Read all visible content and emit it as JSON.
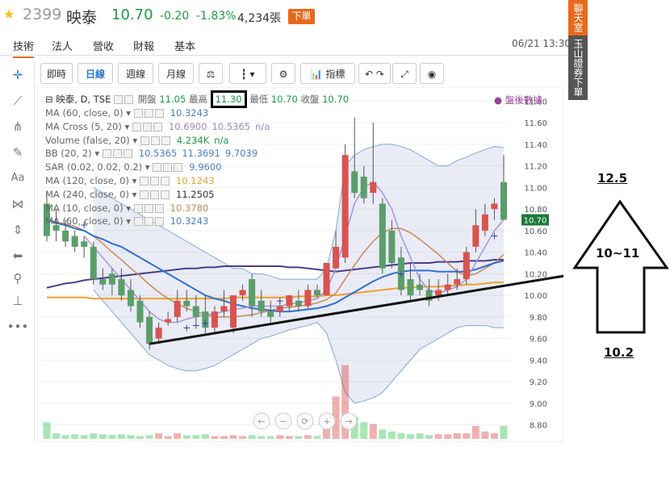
{
  "header": {
    "star_icon": "star-icon",
    "code": "2399",
    "name": "映泰",
    "price": "10.70",
    "change": "-0.20",
    "change_pct": "-1.83%",
    "volume": "4,234張",
    "order_button": "下單",
    "up_color": "#d9534f",
    "down_color": "#1b9a45"
  },
  "tabs": [
    "技術",
    "法人",
    "營收",
    "財報",
    "基本"
  ],
  "timestamp": "06/21 13:30",
  "promo": {
    "top": "聊天室",
    "text": "玉山證券下單"
  },
  "toolbar": {
    "buttons": [
      "即時",
      "日線",
      "週線",
      "月線"
    ],
    "indicator_label": "指標"
  },
  "legend": {
    "main_title": "映泰, D, TSE",
    "open_label": "開盤",
    "open": "11.05",
    "high_label": "最高",
    "high": "11.30",
    "low_label": "最低",
    "low": "10.70",
    "close_label": "收盤",
    "close": "10.70",
    "after_hours": "盤後數據",
    "lines": [
      {
        "name": "MA (60, close, 0)",
        "value": "10.3243",
        "color": "#4a7fc4"
      },
      {
        "name": "MA Cross (5, 20)",
        "value": "10.6900",
        "value2": "10.5365",
        "value3": "n/a",
        "color": "#9b88c4"
      },
      {
        "name": "Volume (false, 20)",
        "value": "4.234K",
        "value2": "n/a",
        "color": "#1b9a45"
      },
      {
        "name": "BB (20, 2)",
        "value": "10.5365",
        "value2": "11.3691",
        "value3": "9.7039",
        "color": "#4a7fc4"
      },
      {
        "name": "SAR (0.02, 0.02, 0.2)",
        "value": "9.9600",
        "color": "#4a7fc4"
      },
      {
        "name": "MA (120, close, 0)",
        "value": "10.1243",
        "color": "#f0a030"
      },
      {
        "name": "MA (240, close, 0)",
        "value": "11.2505",
        "color": "#333333"
      },
      {
        "name": "MA (10, close, 0)",
        "value": "10.3780",
        "color": "#c88a5a"
      },
      {
        "name": "MA (60, close, 0)",
        "value": "10.3243",
        "color": "#4a7fc4"
      }
    ]
  },
  "annotations": {
    "target": "12.5",
    "range": "10~11",
    "base": "10.2"
  },
  "chart_data": {
    "type": "candlestick",
    "ylim": [
      8.7,
      11.9
    ],
    "y_ticks": [
      "11.80",
      "11.60",
      "11.40",
      "11.20",
      "11.00",
      "10.80",
      "10.60",
      "10.40",
      "10.20",
      "10.00",
      "9.80",
      "9.60",
      "9.40",
      "9.20",
      "9.00",
      "8.80"
    ],
    "last_price_label": "10.70",
    "candles": [
      {
        "o": 10.85,
        "h": 10.95,
        "c": 10.55,
        "l": 10.5
      },
      {
        "o": 10.65,
        "h": 10.8,
        "c": 10.6,
        "l": 10.5
      },
      {
        "o": 10.6,
        "h": 10.7,
        "c": 10.5,
        "l": 10.45
      },
      {
        "o": 10.55,
        "h": 10.6,
        "c": 10.45,
        "l": 10.4
      },
      {
        "o": 10.5,
        "h": 10.55,
        "c": 10.45,
        "l": 10.35
      },
      {
        "o": 10.45,
        "h": 10.5,
        "c": 10.15,
        "l": 10.1
      },
      {
        "o": 10.15,
        "h": 10.25,
        "c": 10.1,
        "l": 10.05
      },
      {
        "o": 10.2,
        "h": 10.25,
        "c": 10.1,
        "l": 10.0
      },
      {
        "o": 10.15,
        "h": 10.25,
        "c": 10.0,
        "l": 9.95
      },
      {
        "o": 10.05,
        "h": 10.15,
        "c": 9.9,
        "l": 9.85
      },
      {
        "o": 9.95,
        "h": 10.0,
        "c": 9.75,
        "l": 9.7
      },
      {
        "o": 9.8,
        "h": 9.85,
        "c": 9.55,
        "l": 9.5
      },
      {
        "o": 9.6,
        "h": 9.75,
        "c": 9.7,
        "l": 9.55
      },
      {
        "o": 9.75,
        "h": 9.85,
        "c": 9.78,
        "l": 9.72
      },
      {
        "o": 9.8,
        "h": 10.05,
        "c": 9.95,
        "l": 9.75
      },
      {
        "o": 9.95,
        "h": 10.05,
        "c": 9.9,
        "l": 9.85
      },
      {
        "o": 9.9,
        "h": 10.0,
        "c": 9.8,
        "l": 9.75
      },
      {
        "o": 9.85,
        "h": 10.0,
        "c": 9.7,
        "l": 9.65
      },
      {
        "o": 9.7,
        "h": 9.9,
        "c": 9.85,
        "l": 9.65
      },
      {
        "o": 9.85,
        "h": 10.05,
        "c": 9.9,
        "l": 9.8
      },
      {
        "o": 9.7,
        "h": 10.0,
        "c": 10.0,
        "l": 9.65
      },
      {
        "o": 10.0,
        "h": 10.1,
        "c": 10.05,
        "l": 9.95
      },
      {
        "o": 10.15,
        "h": 10.2,
        "c": 9.9,
        "l": 9.8
      },
      {
        "o": 9.95,
        "h": 10.05,
        "c": 9.85,
        "l": 9.8
      },
      {
        "o": 9.85,
        "h": 9.95,
        "c": 9.8,
        "l": 9.75
      },
      {
        "o": 9.85,
        "h": 9.95,
        "c": 9.9,
        "l": 9.8
      },
      {
        "o": 9.9,
        "h": 10.0,
        "c": 10.0,
        "l": 9.85
      },
      {
        "o": 9.95,
        "h": 10.05,
        "c": 9.9,
        "l": 9.85
      },
      {
        "o": 9.9,
        "h": 10.1,
        "c": 10.05,
        "l": 9.88
      },
      {
        "o": 10.05,
        "h": 10.1,
        "c": 10.0,
        "l": 9.98
      },
      {
        "o": 10.0,
        "h": 10.3,
        "c": 10.3,
        "l": 10.0
      },
      {
        "o": 10.25,
        "h": 10.6,
        "c": 10.45,
        "l": 10.25
      },
      {
        "o": 10.35,
        "h": 11.4,
        "c": 11.3,
        "l": 10.3
      },
      {
        "o": 11.15,
        "h": 11.65,
        "c": 10.95,
        "l": 10.9
      },
      {
        "o": 11.1,
        "h": 11.2,
        "c": 10.9,
        "l": 10.85
      },
      {
        "o": 10.95,
        "h": 11.6,
        "c": 11.05,
        "l": 10.85
      },
      {
        "o": 10.85,
        "h": 10.9,
        "c": 10.25,
        "l": 10.2
      },
      {
        "o": 10.6,
        "h": 10.7,
        "c": 10.3,
        "l": 10.25
      },
      {
        "o": 10.35,
        "h": 10.45,
        "c": 10.05,
        "l": 10.0
      },
      {
        "o": 10.15,
        "h": 10.3,
        "c": 10.0,
        "l": 9.95
      },
      {
        "o": 10.1,
        "h": 10.2,
        "c": 10.05,
        "l": 10.0
      },
      {
        "o": 10.05,
        "h": 10.15,
        "c": 9.95,
        "l": 9.9
      },
      {
        "o": 10.0,
        "h": 10.15,
        "c": 10.05,
        "l": 9.95
      },
      {
        "o": 10.05,
        "h": 10.2,
        "c": 10.1,
        "l": 10.0
      },
      {
        "o": 10.1,
        "h": 10.25,
        "c": 10.15,
        "l": 10.05
      },
      {
        "o": 10.15,
        "h": 10.45,
        "c": 10.4,
        "l": 10.1
      },
      {
        "o": 10.45,
        "h": 10.8,
        "c": 10.65,
        "l": 10.4
      },
      {
        "o": 10.6,
        "h": 10.85,
        "c": 10.75,
        "l": 10.55
      },
      {
        "o": 10.8,
        "h": 10.9,
        "c": 10.85,
        "l": 10.7
      },
      {
        "o": 11.05,
        "h": 11.3,
        "c": 10.7,
        "l": 10.7
      }
    ],
    "volumes": [
      0.9,
      0.3,
      0.2,
      0.25,
      0.2,
      0.3,
      0.25,
      0.2,
      0.25,
      0.2,
      0.15,
      0.2,
      0.3,
      0.15,
      0.3,
      0.2,
      0.2,
      0.25,
      0.15,
      0.15,
      0.2,
      0.15,
      0.2,
      0.15,
      0.15,
      0.2,
      0.15,
      0.15,
      0.2,
      0.15,
      0.6,
      2.3,
      4.0,
      1.2,
      0.9,
      0.8,
      0.5,
      0.4,
      0.3,
      0.25,
      0.3,
      0.2,
      0.25,
      0.25,
      0.3,
      0.3,
      0.7,
      0.4,
      0.3,
      0.7
    ],
    "bb_upper": [
      null,
      null,
      null,
      null,
      null,
      11.0,
      10.95,
      10.9,
      10.85,
      10.8,
      10.75,
      10.7,
      10.65,
      10.6,
      10.55,
      10.5,
      10.45,
      10.4,
      10.35,
      10.3,
      10.25,
      10.25,
      10.2,
      10.2,
      10.18,
      10.15,
      10.15,
      10.15,
      10.15,
      10.15,
      10.25,
      10.6,
      11.2,
      11.3,
      11.35,
      11.38,
      11.4,
      11.4,
      11.38,
      11.35,
      11.3,
      11.25,
      11.2,
      11.2,
      11.25,
      11.28,
      11.32,
      11.35,
      11.38,
      11.37
    ],
    "bb_lower": [
      null,
      null,
      null,
      null,
      null,
      10.05,
      9.95,
      9.85,
      9.75,
      9.65,
      9.55,
      9.45,
      9.4,
      9.35,
      9.32,
      9.3,
      9.3,
      9.32,
      9.35,
      9.4,
      9.45,
      9.5,
      9.55,
      9.6,
      9.62,
      9.65,
      9.68,
      9.7,
      9.72,
      9.75,
      9.65,
      9.4,
      9.1,
      9.0,
      9.02,
      9.05,
      9.1,
      9.2,
      9.3,
      9.4,
      9.5,
      9.55,
      9.6,
      9.65,
      9.7,
      9.72,
      9.72,
      9.72,
      9.7,
      9.7
    ],
    "ma60": [
      10.7,
      10.67,
      10.65,
      10.62,
      10.6,
      10.55,
      10.52,
      10.48,
      10.45,
      10.4,
      10.35,
      10.3,
      10.25,
      10.2,
      10.15,
      10.1,
      10.05,
      10.0,
      9.97,
      9.95,
      9.92,
      9.9,
      9.88,
      9.87,
      9.86,
      9.85,
      9.85,
      9.86,
      9.87,
      9.88,
      9.9,
      9.93,
      9.98,
      10.03,
      10.08,
      10.13,
      10.17,
      10.2,
      10.22,
      10.23,
      10.23,
      10.23,
      10.22,
      10.22,
      10.22,
      10.22,
      10.24,
      10.27,
      10.3,
      10.32
    ],
    "ma120": [
      9.98,
      9.98,
      9.98,
      9.98,
      9.98,
      9.97,
      9.97,
      9.97,
      9.97,
      9.97,
      9.97,
      9.97,
      9.97,
      9.97,
      9.97,
      9.97,
      9.97,
      9.97,
      9.97,
      9.97,
      9.98,
      9.98,
      9.98,
      9.98,
      9.98,
      9.98,
      9.98,
      9.99,
      9.99,
      9.99,
      10.0,
      10.0,
      10.01,
      10.02,
      10.03,
      10.04,
      10.05,
      10.06,
      10.07,
      10.07,
      10.08,
      10.08,
      10.08,
      10.09,
      10.09,
      10.1,
      10.1,
      10.11,
      10.12,
      10.12
    ],
    "ma240": [
      10.07,
      10.09,
      10.11,
      10.12,
      10.14,
      10.15,
      10.16,
      10.17,
      10.18,
      10.19,
      10.2,
      10.21,
      10.22,
      10.23,
      10.24,
      10.25,
      10.25,
      10.26,
      10.26,
      10.27,
      10.27,
      10.27,
      10.27,
      10.27,
      10.27,
      10.27,
      10.26,
      10.26,
      10.25,
      10.24,
      10.23,
      10.22,
      10.23,
      10.24,
      10.25,
      10.26,
      10.27,
      10.28,
      10.29,
      10.3,
      10.3,
      10.3,
      10.31,
      10.31,
      10.31,
      10.32,
      10.32,
      10.32,
      10.33,
      10.33
    ],
    "ma10": [
      10.7,
      10.68,
      10.66,
      10.64,
      10.6,
      10.55,
      10.48,
      10.4,
      10.33,
      10.25,
      10.18,
      10.1,
      10.03,
      9.97,
      9.92,
      9.88,
      9.85,
      9.82,
      9.8,
      9.8,
      9.8,
      9.81,
      9.82,
      9.84,
      9.86,
      9.88,
      9.89,
      9.9,
      9.91,
      9.93,
      9.96,
      10.02,
      10.15,
      10.28,
      10.4,
      10.5,
      10.58,
      10.62,
      10.62,
      10.58,
      10.52,
      10.45,
      10.38,
      10.3,
      10.22,
      10.18,
      10.2,
      10.25,
      10.3,
      10.38
    ],
    "ma5": [
      null,
      null,
      null,
      null,
      10.55,
      10.45,
      10.35,
      10.25,
      10.15,
      10.05,
      9.95,
      9.85,
      9.78,
      9.75,
      9.75,
      9.78,
      9.8,
      9.82,
      9.83,
      9.85,
      9.87,
      9.88,
      9.9,
      9.9,
      9.9,
      9.9,
      9.92,
      9.93,
      9.95,
      9.97,
      10.05,
      10.25,
      10.55,
      10.85,
      11.0,
      11.05,
      10.95,
      10.8,
      10.55,
      10.35,
      10.15,
      10.05,
      10.02,
      10.05,
      10.08,
      10.15,
      10.3,
      10.45,
      10.6,
      10.7
    ],
    "sar": [
      {
        "i": 4,
        "v": 10.65
      },
      {
        "i": 15,
        "v": 9.7
      },
      {
        "i": 16,
        "v": 9.72
      },
      {
        "i": 17,
        "v": 9.74
      },
      {
        "i": 25,
        "v": 9.95
      },
      {
        "i": 38,
        "v": 10.2
      },
      {
        "i": 48,
        "v": 10.55
      }
    ],
    "trendline": {
      "from": [
        9.55,
        11
      ],
      "to": [
        10.15,
        52
      ]
    }
  }
}
